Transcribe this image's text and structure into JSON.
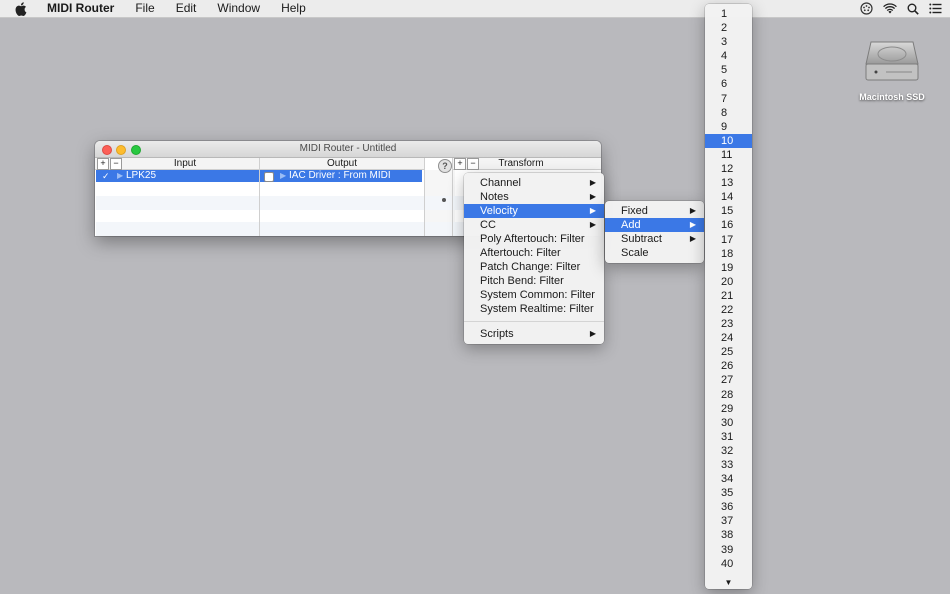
{
  "menubar": {
    "app_name": "MIDI Router",
    "items": [
      "File",
      "Edit",
      "Window",
      "Help"
    ],
    "status_icons": [
      "midi-icon",
      "wifi-icon",
      "search-icon",
      "list-icon"
    ]
  },
  "desktop": {
    "disk_label": "Macintosh SSD"
  },
  "window": {
    "title": "MIDI Router - Untitled",
    "add_label": "+",
    "remove_label": "−",
    "col_input": "Input",
    "col_output": "Output",
    "col_transform": "Transform",
    "help_label": "?",
    "row": {
      "check": "✓",
      "input": "LPK25",
      "output": "IAC Driver : From MIDI Router"
    }
  },
  "context_menu": {
    "items": [
      "Channel",
      "Notes",
      "Velocity",
      "CC",
      "Poly Aftertouch: Filter",
      "Aftertouch: Filter",
      "Patch Change: Filter",
      "Pitch Bend: Filter",
      "System Common: Filter",
      "System Realtime: Filter"
    ],
    "scripts": "Scripts",
    "highlighted": "Velocity"
  },
  "velocity_menu": {
    "items": [
      "Fixed",
      "Add",
      "Subtract",
      "Scale"
    ],
    "highlighted": "Add"
  },
  "add_menu": {
    "numbers": [
      "1",
      "2",
      "3",
      "4",
      "5",
      "6",
      "7",
      "8",
      "9",
      "10",
      "11",
      "12",
      "13",
      "14",
      "15",
      "16",
      "17",
      "18",
      "19",
      "20",
      "21",
      "22",
      "23",
      "24",
      "25",
      "26",
      "27",
      "28",
      "29",
      "30",
      "31",
      "32",
      "33",
      "34",
      "35",
      "36",
      "37",
      "38",
      "39",
      "40"
    ],
    "selected": "10",
    "scroll_indicator": "▼"
  },
  "colors": {
    "accent": "#3b78e6",
    "desktop": "#b9b9bd"
  }
}
